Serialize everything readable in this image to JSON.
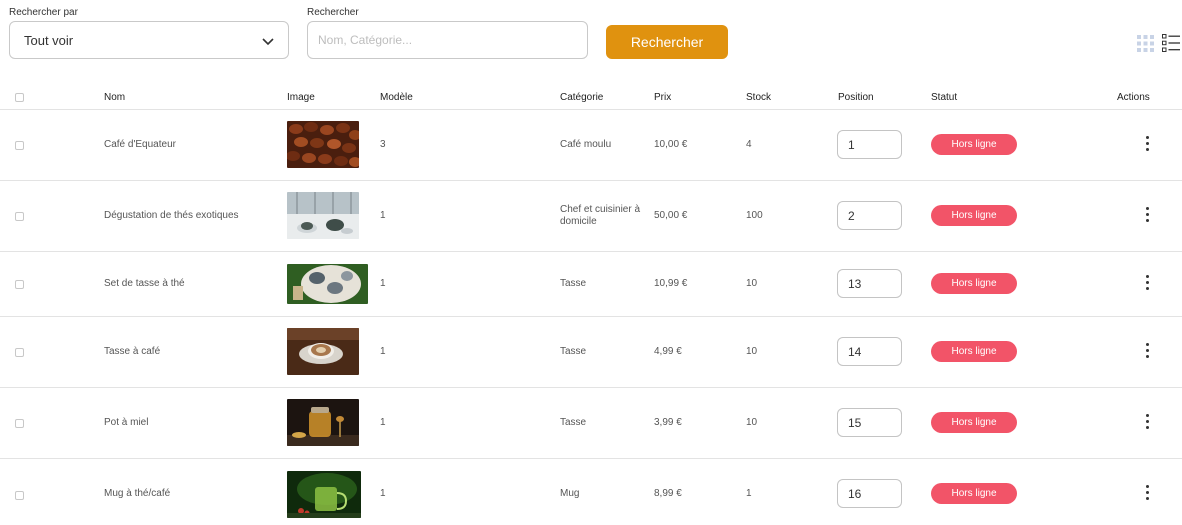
{
  "filters": {
    "search_by_label": "Rechercher par",
    "search_by_value": "Tout voir",
    "search_label": "Rechercher",
    "search_placeholder": "Nom, Catégorie...",
    "search_value": "",
    "search_button": "Rechercher"
  },
  "icons": {
    "dropdown": "chevron-down-icon",
    "grid_view": "grid-view-icon",
    "list_view": "list-view-icon",
    "actions": "kebab-menu-icon"
  },
  "colors": {
    "accent": "#e0920f",
    "status_offline": "#f25468"
  },
  "table": {
    "headers": {
      "name": "Nom",
      "image": "Image",
      "model": "Modèle",
      "category": "Catégorie",
      "price": "Prix",
      "stock": "Stock",
      "position": "Position",
      "status": "Statut",
      "actions": "Actions"
    },
    "rows": [
      {
        "name": "Café d'Equateur",
        "image": "coffee-beans-photo",
        "model": "3",
        "category": "Café moulu",
        "price": "10,00 €",
        "stock": "4",
        "position": "1",
        "status": "Hors ligne"
      },
      {
        "name": "Dégustation de thés exotiques",
        "image": "tea-tasting-photo",
        "model": "1",
        "category": "Chef et cuisinier à domicile",
        "price": "50,00 €",
        "stock": "100",
        "position": "2",
        "status": "Hors ligne"
      },
      {
        "name": "Set de tasse à thé",
        "image": "tea-cup-set-photo",
        "model": "1",
        "category": "Tasse",
        "price": "10,99 €",
        "stock": "10",
        "position": "13",
        "status": "Hors ligne"
      },
      {
        "name": "Tasse à café",
        "image": "coffee-cup-photo",
        "model": "1",
        "category": "Tasse",
        "price": "4,99 €",
        "stock": "10",
        "position": "14",
        "status": "Hors ligne"
      },
      {
        "name": "Pot à miel",
        "image": "honey-pot-photo",
        "model": "1",
        "category": "Tasse",
        "price": "3,99 €",
        "stock": "10",
        "position": "15",
        "status": "Hors ligne"
      },
      {
        "name": "Mug à thé/café",
        "image": "tea-mug-photo",
        "model": "1",
        "category": "Mug",
        "price": "8,99 €",
        "stock": "1",
        "position": "16",
        "status": "Hors ligne"
      }
    ]
  }
}
